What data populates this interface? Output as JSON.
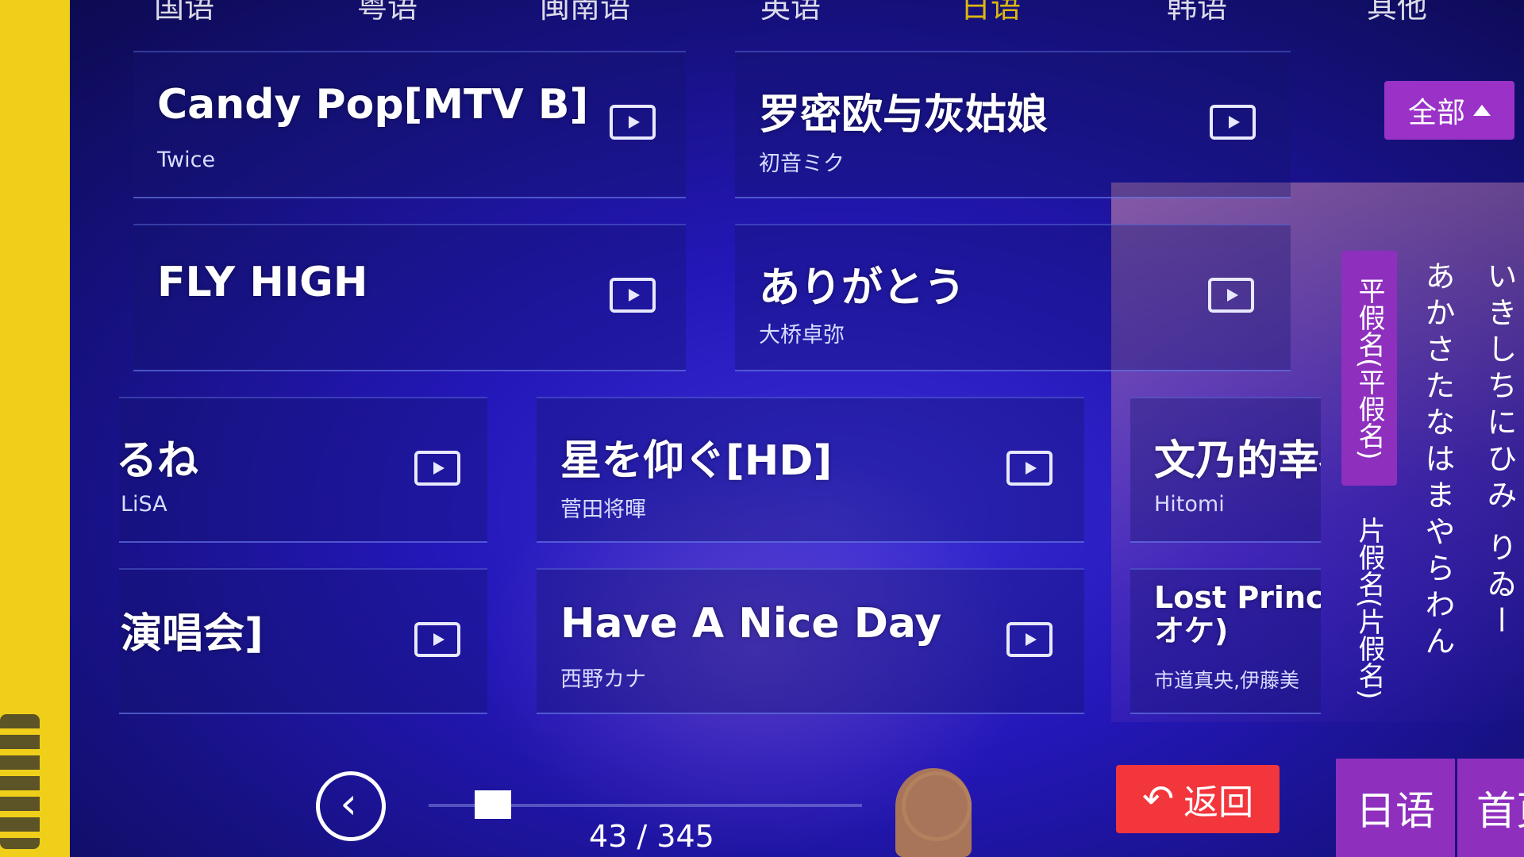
{
  "tabs": [
    {
      "label": "国语",
      "active": false
    },
    {
      "label": "粤语",
      "active": false
    },
    {
      "label": "闽南语",
      "active": false
    },
    {
      "label": "英语",
      "active": false
    },
    {
      "label": "日语",
      "active": true
    },
    {
      "label": "韩语",
      "active": false
    },
    {
      "label": "其他",
      "active": false
    }
  ],
  "songs": [
    {
      "title": "Candy Pop[MTV B]",
      "artist": "Twice"
    },
    {
      "title": "罗密欧与灰姑娘",
      "artist": "初音ミク"
    },
    {
      "title": "FLY HIGH",
      "artist": ""
    },
    {
      "title": "ありがとう",
      "artist": "大桥卓弥"
    },
    {
      "title": "るね",
      "artist": "LiSA"
    },
    {
      "title": "星を仰ぐ[HD]",
      "artist": "菅田将暉"
    },
    {
      "title": "文乃的幸福",
      "artist": "Hitomi"
    },
    {
      "title": "演唱会]",
      "artist": ""
    },
    {
      "title": "Have A Nice Day",
      "artist": "西野カナ"
    },
    {
      "title": "Lost Princes\nオケ)",
      "artist": "市道真央,伊藤美"
    }
  ],
  "filter": {
    "label": "全部"
  },
  "kana": {
    "hiragana_tab": "平假名(平假名)",
    "katakana_tab": "片假名(片假名)",
    "col1": "あかさたなはまやらわん",
    "col2": "いきしちにひみ りゐー"
  },
  "pagination": {
    "current": 43,
    "total": 345,
    "text": "43 / 345"
  },
  "buttons": {
    "return_label": "返回",
    "language_label": "日语",
    "home_label": "首页"
  },
  "colors": {
    "accent_purple": "#8e2fbe",
    "return_red": "#f2363c",
    "active_tab": "#ffd500",
    "background": "#2417b8"
  },
  "icons": [
    "play-icon",
    "chevron-left-icon",
    "return-arrow-icon",
    "triangle-up-icon"
  ]
}
